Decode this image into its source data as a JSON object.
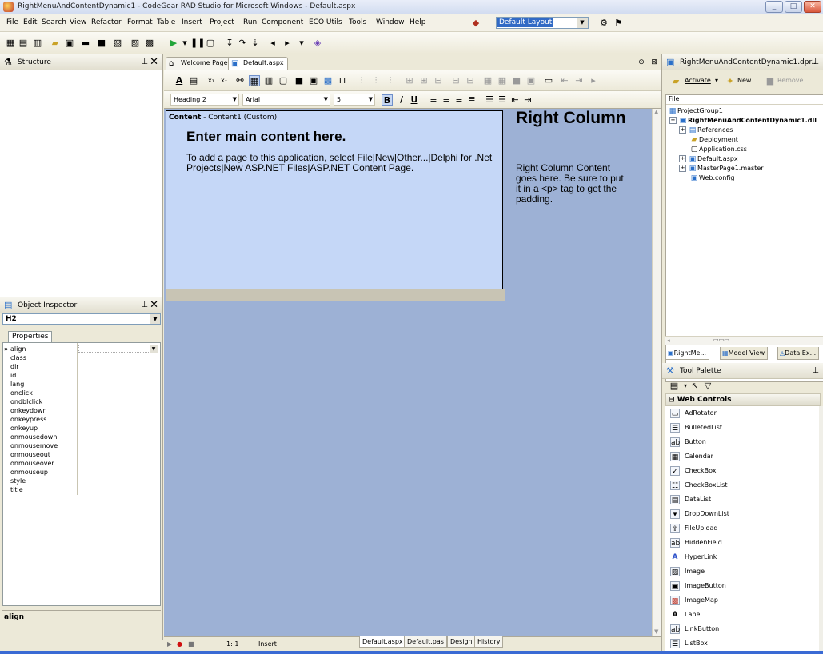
{
  "window": {
    "title": "RightMenuAndContentDynamic1 - CodeGear RAD Studio for Microsoft Windows - Default.aspx"
  },
  "menu": [
    "File",
    "Edit",
    "Search",
    "View",
    "Refactor",
    "Format",
    "Table",
    "Insert",
    "Project",
    "Run",
    "Component",
    "ECO Utils",
    "Tools",
    "Window",
    "Help"
  ],
  "layout_combo": {
    "value": "Default Layout"
  },
  "structure": {
    "title": "Structure"
  },
  "object_inspector": {
    "title": "Object Inspector",
    "selected": "H2",
    "tab": "Properties",
    "properties": [
      "align",
      "class",
      "dir",
      "id",
      "lang",
      "onclick",
      "ondblclick",
      "onkeydown",
      "onkeypress",
      "onkeyup",
      "onmousedown",
      "onmousemove",
      "onmouseout",
      "onmouseover",
      "onmouseup",
      "style",
      "title"
    ],
    "description": "align"
  },
  "editor": {
    "tabs": [
      "Welcome Page",
      "Default.aspx"
    ],
    "style_combo": "Heading 2",
    "font_combo": "Arial",
    "size_combo": "5",
    "bold": "B",
    "italic": "/",
    "underline": "U"
  },
  "design": {
    "content_label_bold": "Content",
    "content_label_rest": " - Content1 (Custom)",
    "main_heading": "Enter main content here.",
    "main_text": "To add a page to this application, select File|New|Other...|Delphi for .Net Projects|New ASP.NET Files|ASP.NET Content Page.",
    "right_heading": "Right Column",
    "right_text": "Right Column Content goes here. Be sure to put it in a <p> tag to get the padding."
  },
  "status": {
    "position": "1:  1",
    "mode": "Insert",
    "bottom_tabs": [
      "Default.aspx",
      "Default.pas",
      "Design",
      "History"
    ]
  },
  "project_manager": {
    "title": "RightMenuAndContentDynamic1.dpr...",
    "activate": "Activate",
    "new": "New",
    "remove": "Remove",
    "file_header": "File",
    "tree": [
      {
        "label": "ProjectGroup1",
        "bold": false
      },
      {
        "label": "RightMenuAndContentDynamic1.dll",
        "bold": true
      },
      {
        "label": "References",
        "bold": false
      },
      {
        "label": "Deployment",
        "bold": false
      },
      {
        "label": "Application.css",
        "bold": false
      },
      {
        "label": "Default.aspx",
        "bold": false
      },
      {
        "label": "MasterPage1.master",
        "bold": false
      },
      {
        "label": "Web.config",
        "bold": false
      }
    ],
    "tabs": [
      "RightMe...",
      "Model View",
      "Data Ex..."
    ]
  },
  "tool_palette": {
    "title": "Tool Palette",
    "category": "Web Controls",
    "items": [
      "AdRotator",
      "BulletedList",
      "Button",
      "Calendar",
      "CheckBox",
      "CheckBoxList",
      "DataList",
      "DropDownList",
      "FileUpload",
      "HiddenField",
      "HyperLink",
      "Image",
      "ImageButton",
      "ImageMap",
      "Label",
      "LinkButton",
      "ListBox"
    ]
  }
}
